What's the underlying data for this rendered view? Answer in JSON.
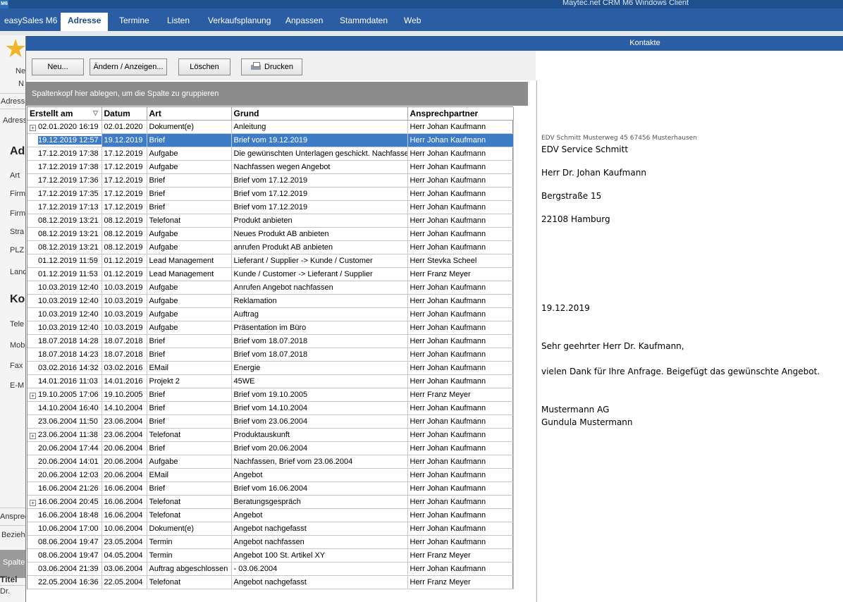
{
  "window": {
    "title": "Maytec.net CRM M6 Windows Client",
    "logo": "M6"
  },
  "menu": {
    "tabs": [
      "easySales M6",
      "Adresse",
      "Termine",
      "Listen",
      "Verkaufsplanung",
      "Anpassen",
      "Stammdaten",
      "Web"
    ],
    "active_index": 1
  },
  "left_panel": {
    "ribbon_label_1": "Ne",
    "ribbon_label_2": "N",
    "tab_1": "Adressp",
    "tab_2": "Adress",
    "section_address": "Ad",
    "fields": [
      "Art",
      "Firm",
      "Firm",
      "Stra",
      "PLZ",
      "Land"
    ],
    "section_contact": "Ko",
    "contact_fields": [
      "Tele",
      "Mob",
      "Fax",
      "E-M"
    ],
    "bottom_1": "Ansprec",
    "bottom_2": "Bezieh",
    "bottom_3": "Spalte",
    "col_title": "Titel",
    "col_value": "Dr."
  },
  "dialog": {
    "title": "Kontakte",
    "buttons": {
      "new": "Neu...",
      "edit": "Ändern / Anzeigen...",
      "delete": "Löschen",
      "print": "Drucken"
    },
    "group_hint": "Spaltenkopf hier ablegen, um die Spalte zu gruppieren",
    "columns": [
      "Erstellt am",
      "Datum",
      "Art",
      "Grund",
      "Ansprechpartner"
    ],
    "rows": [
      {
        "exp": true,
        "created": "02.01.2020 16:19",
        "date": "02.01.2020",
        "type": "Dokument(e)",
        "reason": "Anleitung",
        "contact": "Herr Johan Kaufmann"
      },
      {
        "exp": false,
        "sel": true,
        "created": "19.12.2019 12:57",
        "date": "19.12.2019",
        "type": "Brief",
        "reason": "Brief vom 19.12.2019",
        "contact": "Herr Johan Kaufmann"
      },
      {
        "exp": false,
        "created": "17.12.2019 17:38",
        "date": "17.12.2019",
        "type": "Aufgabe",
        "reason": "Die gewünschten Unterlagen geschickt. Nachfassen",
        "contact": "Herr Johan Kaufmann"
      },
      {
        "exp": false,
        "created": "17.12.2019 17:38",
        "date": "17.12.2019",
        "type": "Aufgabe",
        "reason": "Nachfassen wegen Angebot",
        "contact": "Herr Johan Kaufmann"
      },
      {
        "exp": false,
        "created": "17.12.2019 17:36",
        "date": "17.12.2019",
        "type": "Brief",
        "reason": "Brief vom 17.12.2019",
        "contact": "Herr Johan Kaufmann"
      },
      {
        "exp": false,
        "created": "17.12.2019 17:35",
        "date": "17.12.2019",
        "type": "Brief",
        "reason": "Brief vom 17.12.2019",
        "contact": "Herr Johan Kaufmann"
      },
      {
        "exp": false,
        "created": "17.12.2019 17:13",
        "date": "17.12.2019",
        "type": "Brief",
        "reason": "Brief vom 17.12.2019",
        "contact": "Herr Johan Kaufmann"
      },
      {
        "exp": false,
        "created": "08.12.2019 13:21",
        "date": "08.12.2019",
        "type": "Telefonat",
        "reason": "Produkt anbieten",
        "contact": "Herr Johan Kaufmann"
      },
      {
        "exp": false,
        "created": "08.12.2019 13:21",
        "date": "08.12.2019",
        "type": "Aufgabe",
        "reason": "Neues Produkt AB anbieten",
        "contact": "Herr Johan Kaufmann"
      },
      {
        "exp": false,
        "created": "08.12.2019 13:21",
        "date": "08.12.2019",
        "type": "Aufgabe",
        "reason": "anrufen Produkt AB anbieten",
        "contact": "Herr Johan Kaufmann"
      },
      {
        "exp": false,
        "created": "01.12.2019 11:59",
        "date": "01.12.2019",
        "type": "Lead Management",
        "reason": "Lieferant / Supplier -> Kunde / Customer",
        "contact": "Herr Stevka Scheel"
      },
      {
        "exp": false,
        "created": "01.12.2019 11:53",
        "date": "01.12.2019",
        "type": "Lead Management",
        "reason": "Kunde / Customer -> Lieferant / Supplier",
        "contact": "Herr Franz Meyer"
      },
      {
        "exp": false,
        "created": "10.03.2019 12:40",
        "date": "10.03.2019",
        "type": "Aufgabe",
        "reason": "Anrufen Angebot nachfassen",
        "contact": "Herr Johan Kaufmann"
      },
      {
        "exp": false,
        "created": "10.03.2019 12:40",
        "date": "10.03.2019",
        "type": "Aufgabe",
        "reason": "Reklamation",
        "contact": "Herr Johan Kaufmann"
      },
      {
        "exp": false,
        "created": "10.03.2019 12:40",
        "date": "10.03.2019",
        "type": "Aufgabe",
        "reason": "Auftrag",
        "contact": "Herr Johan Kaufmann"
      },
      {
        "exp": false,
        "created": "10.03.2019 12:40",
        "date": "10.03.2019",
        "type": "Aufgabe",
        "reason": "Präsentation im Büro",
        "contact": "Herr Johan Kaufmann"
      },
      {
        "exp": false,
        "created": "18.07.2018 14:28",
        "date": "18.07.2018",
        "type": "Brief",
        "reason": "Brief vom 18.07.2018",
        "contact": "Herr Johan Kaufmann"
      },
      {
        "exp": false,
        "created": "18.07.2018 14:23",
        "date": "18.07.2018",
        "type": "Brief",
        "reason": "Brief vom 18.07.2018",
        "contact": "Herr Johan Kaufmann"
      },
      {
        "exp": false,
        "created": "03.02.2016 14:32",
        "date": "03.02.2016",
        "type": "EMail",
        "reason": "Energie",
        "contact": "Herr Johan Kaufmann"
      },
      {
        "exp": false,
        "created": "14.01.2016 11:03",
        "date": "14.01.2016",
        "type": "Projekt 2",
        "reason": "45WE",
        "contact": "Herr Johan Kaufmann"
      },
      {
        "exp": true,
        "created": "19.10.2005 17:06",
        "date": "19.10.2005",
        "type": "Brief",
        "reason": "Brief vom 19.10.2005",
        "contact": "Herr Franz Meyer"
      },
      {
        "exp": false,
        "created": "14.10.2004 16:40",
        "date": "14.10.2004",
        "type": "Brief",
        "reason": "Brief vom 14.10.2004",
        "contact": "Herr Johan Kaufmann"
      },
      {
        "exp": false,
        "created": "23.06.2004 11:50",
        "date": "23.06.2004",
        "type": "Brief",
        "reason": "Brief vom 23.06.2004",
        "contact": "Herr Johan Kaufmann"
      },
      {
        "exp": true,
        "created": "23.06.2004 11:38",
        "date": "23.06.2004",
        "type": "Telefonat",
        "reason": "Produktauskunft",
        "contact": "Herr Johan Kaufmann"
      },
      {
        "exp": false,
        "created": "20.06.2004 17:44",
        "date": "20.06.2004",
        "type": "Brief",
        "reason": "Brief vom 20.06.2004",
        "contact": "Herr Johan Kaufmann"
      },
      {
        "exp": false,
        "created": "20.06.2004 14:01",
        "date": "20.06.2004",
        "type": "Aufgabe",
        "reason": "Nachfassen, Brief vom 23.06.2004",
        "contact": "Herr Johan Kaufmann"
      },
      {
        "exp": false,
        "created": "20.06.2004 12:03",
        "date": "20.06.2004",
        "type": "EMail",
        "reason": "Angebot",
        "contact": "Herr Johan Kaufmann"
      },
      {
        "exp": false,
        "created": "16.06.2004 21:26",
        "date": "16.06.2004",
        "type": "Brief",
        "reason": "Brief vom 16.06.2004",
        "contact": "Herr Johan Kaufmann"
      },
      {
        "exp": true,
        "created": "16.06.2004 20:45",
        "date": "16.06.2004",
        "type": "Telefonat",
        "reason": "Beratungsgespräch",
        "contact": "Herr Johan Kaufmann"
      },
      {
        "exp": false,
        "created": "16.06.2004 18:48",
        "date": "16.06.2004",
        "type": "Telefonat",
        "reason": "Angebot",
        "contact": "Herr Johan Kaufmann"
      },
      {
        "exp": false,
        "created": "10.06.2004 17:00",
        "date": "10.06.2004",
        "type": "Dokument(e)",
        "reason": "Angebot nachgefasst",
        "contact": "Herr Johan Kaufmann"
      },
      {
        "exp": false,
        "created": "08.06.2004 19:47",
        "date": "23.05.2004",
        "type": "Termin",
        "reason": "Angebot nachfassen",
        "contact": "Herr Johan Kaufmann"
      },
      {
        "exp": false,
        "created": "08.06.2004 19:47",
        "date": "04.05.2004",
        "type": "Termin",
        "reason": "Angebot 100 St. Artikel XY",
        "contact": "Herr Franz Meyer"
      },
      {
        "exp": false,
        "created": "03.06.2004 21:39",
        "date": "03.06.2004",
        "type": "Auftrag abgeschlossen",
        "reason": " - 03.06.2004",
        "contact": "Herr Johan Kaufmann"
      },
      {
        "exp": false,
        "created": "22.05.2004 16:36",
        "date": "22.05.2004",
        "type": "Telefonat",
        "reason": "Angebot nachgefasst",
        "contact": "Herr Franz Meyer"
      }
    ]
  },
  "preview": {
    "sender_line": "EDV Schmitt Musterweg 45 67456 Musterhausen",
    "company": "EDV Service Schmitt",
    "recipient": "Herr Dr. Johan Kaufmann",
    "street": "Bergstraße 15",
    "city": "22108 Hamburg",
    "date": "19.12.2019",
    "salutation": "Sehr geehrter Herr Dr. Kaufmann,",
    "body": "vielen Dank für Ihre Anfrage. Beigefügt das gewünschte Angebot.",
    "closing_company": "Mustermann AG",
    "closing_name": "Gundula Mustermann"
  },
  "colors": {
    "titlebar": "#1e4f8f",
    "menubar": "#2a5da4",
    "selection": "#3e7cc7",
    "groupbar": "#8c8c8c"
  }
}
